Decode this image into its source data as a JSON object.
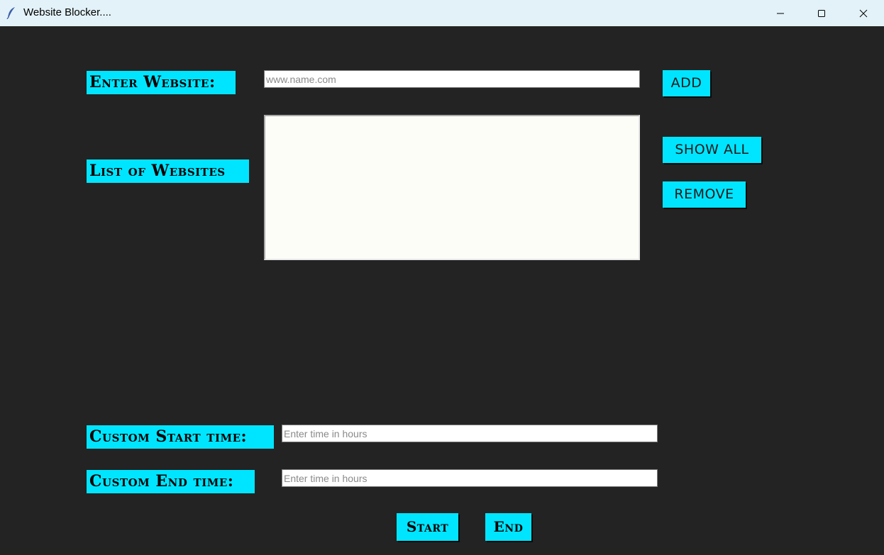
{
  "window": {
    "title": "Website Blocker....",
    "icon": "feather-icon",
    "controls": [
      "minimize-icon",
      "maximize-icon",
      "close-icon"
    ]
  },
  "colors": {
    "background": "#232323",
    "accent": "#00e5ff",
    "titlebar": "#e3f2f8"
  },
  "form": {
    "website_label": "Enter Website:",
    "website_input": {
      "value": "",
      "placeholder": "www.name.com"
    },
    "add_button": "ADD",
    "list_label": "List of Websites",
    "list_items": [],
    "show_all_button": "SHOW ALL",
    "remove_button": "REMOVE",
    "start_time_label": "Custom Start time:",
    "start_time_input": {
      "value": "",
      "placeholder": "Enter time in hours"
    },
    "end_time_label": "Custom End time:",
    "end_time_input": {
      "value": "",
      "placeholder": "Enter time in hours"
    },
    "start_button": "Start",
    "end_button": "End"
  }
}
